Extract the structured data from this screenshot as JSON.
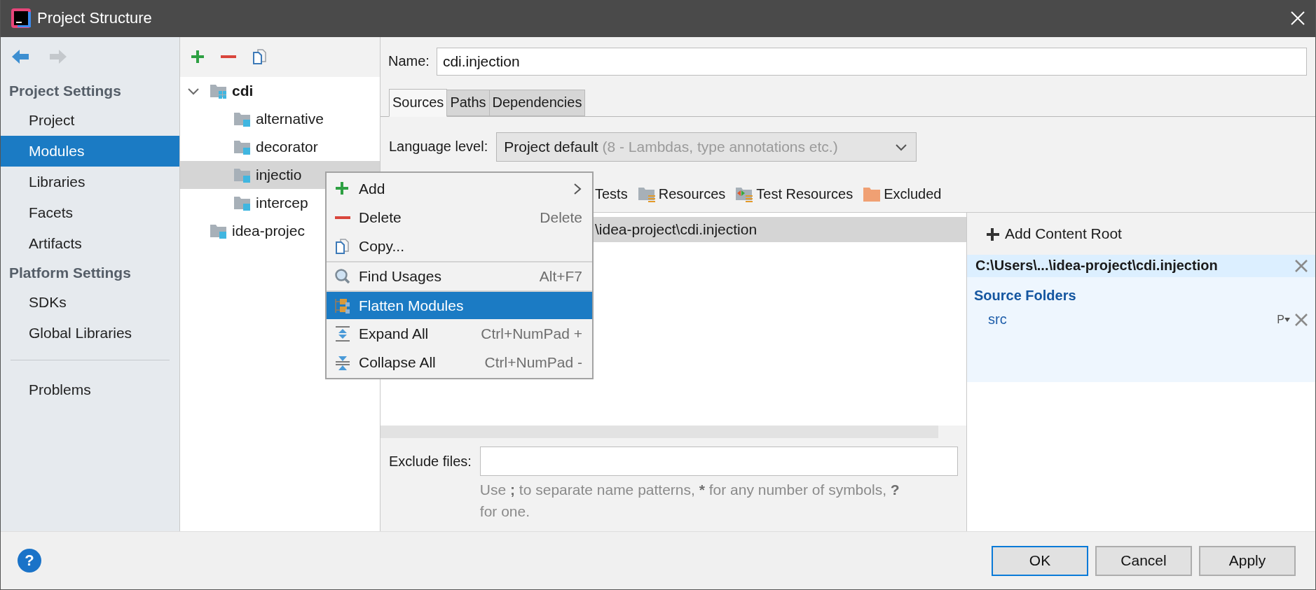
{
  "window": {
    "title": "Project Structure"
  },
  "navigation": {
    "back": {
      "disabled": false
    },
    "forward": {
      "disabled": true
    }
  },
  "sidebar": {
    "sections": [
      {
        "heading": "Project Settings",
        "items": [
          {
            "label": "Project",
            "selected": false
          },
          {
            "label": "Modules",
            "selected": true
          },
          {
            "label": "Libraries",
            "selected": false
          },
          {
            "label": "Facets",
            "selected": false
          },
          {
            "label": "Artifacts",
            "selected": false
          }
        ]
      },
      {
        "heading": "Platform Settings",
        "items": [
          {
            "label": "SDKs",
            "selected": false
          },
          {
            "label": "Global Libraries",
            "selected": false
          }
        ]
      }
    ],
    "extra_items": [
      {
        "label": "Problems",
        "selected": false
      }
    ]
  },
  "module_tree": {
    "items": [
      {
        "label": "cdi",
        "kind": "module",
        "selected": false,
        "expanded": true,
        "children": [
          {
            "label": "alternative",
            "kind": "folder",
            "selected": false
          },
          {
            "label": "decorator",
            "kind": "folder",
            "selected": false
          },
          {
            "label": "injectio",
            "kind": "folder",
            "selected": true
          },
          {
            "label": "intercep",
            "kind": "folder",
            "selected": false
          }
        ]
      },
      {
        "label": "idea-projec",
        "kind": "folder",
        "selected": false
      }
    ]
  },
  "editor": {
    "name_label": "Name:",
    "name_value": "cdi.injection",
    "tabs": [
      {
        "label": "Sources",
        "selected": true
      },
      {
        "label": "Paths",
        "selected": false
      },
      {
        "label": "Dependencies",
        "selected": false
      }
    ],
    "language_level": {
      "label": "Language level:",
      "value": "Project default",
      "hint": "(8 - Lambdas, type annotations etc.)"
    },
    "mark_as": [
      {
        "label": "Tests"
      },
      {
        "label": "Resources"
      },
      {
        "label": "Test Resources"
      },
      {
        "label": "Excluded"
      }
    ],
    "content_rows": [
      {
        "path": "\\idea-project\\cdi.injection",
        "selected": true
      }
    ],
    "exclude_files": {
      "label": "Exclude files:",
      "hint_parts": [
        {
          "text": "Use ",
          "bold": false
        },
        {
          "text": ";",
          "bold": true
        },
        {
          "text": " to separate name patterns, ",
          "bold": false
        },
        {
          "text": "*",
          "bold": true
        },
        {
          "text": " for any number of symbols, ",
          "bold": false
        },
        {
          "text": "?",
          "bold": true
        },
        {
          "text": " for one.",
          "bold": false
        }
      ]
    }
  },
  "content_root_panel": {
    "add_button": "Add Content Root",
    "root_path": "C:\\Users\\...\\idea-project\\cdi.injection",
    "source_folders_heading": "Source Folders",
    "source_folders": [
      {
        "name": "src",
        "prefix_label": "P"
      }
    ]
  },
  "context_menu": {
    "items": [
      {
        "label": "Add",
        "submenu": true,
        "separator_before": false,
        "selected": false
      },
      {
        "label": "Delete",
        "shortcut": "Delete",
        "submenu": false,
        "separator_before": false,
        "selected": false
      },
      {
        "label": "Copy...",
        "submenu": false,
        "separator_before": false,
        "selected": false
      },
      {
        "label": "Find Usages",
        "shortcut": "Alt+F7",
        "submenu": false,
        "separator_before": true,
        "selected": false
      },
      {
        "label": "Flatten Modules",
        "submenu": false,
        "separator_before": true,
        "selected": true
      },
      {
        "label": "Expand All",
        "shortcut": "Ctrl+NumPad +",
        "submenu": false,
        "separator_before": false,
        "selected": false
      },
      {
        "label": "Collapse All",
        "shortcut": "Ctrl+NumPad -",
        "submenu": false,
        "separator_before": false,
        "selected": false
      }
    ]
  },
  "footer": {
    "help": "?",
    "buttons": [
      {
        "label": "OK",
        "default": true
      },
      {
        "label": "Cancel",
        "default": false
      },
      {
        "label": "Apply",
        "default": false
      }
    ]
  }
}
